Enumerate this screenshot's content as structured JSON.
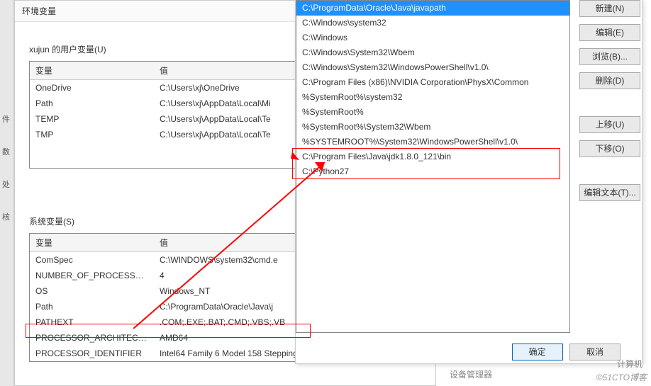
{
  "leftStrip": [
    "件",
    "数",
    "处",
    "核"
  ],
  "bgWindow": {
    "title": "环境变量",
    "userVarsHeader": "xujun 的用户变量(U)",
    "sysVarsHeader": "系统变量(S)",
    "colVar": "变量",
    "colVal": "值",
    "userVars": [
      {
        "name": "OneDrive",
        "value": "C:\\Users\\xj\\OneDrive"
      },
      {
        "name": "Path",
        "value": "C:\\Users\\xj\\AppData\\Local\\Mi"
      },
      {
        "name": "TEMP",
        "value": "C:\\Users\\xj\\AppData\\Local\\Te"
      },
      {
        "name": "TMP",
        "value": "C:\\Users\\xj\\AppData\\Local\\Te"
      }
    ],
    "sysVars": [
      {
        "name": "ComSpec",
        "value": "C:\\WINDOWS\\system32\\cmd.e"
      },
      {
        "name": "NUMBER_OF_PROCESSORS",
        "value": "4"
      },
      {
        "name": "OS",
        "value": "Windows_NT"
      },
      {
        "name": "Path",
        "value": "C:\\ProgramData\\Oracle\\Java\\j"
      },
      {
        "name": "PATHEXT",
        "value": ".COM;.EXE;.BAT;.CMD;.VBS;.VB"
      },
      {
        "name": "PROCESSOR_ARCHITECTU...",
        "value": "AMD64"
      },
      {
        "name": "PROCESSOR_IDENTIFIER",
        "value": "Intel64 Family 6 Model 158 Stepping 9, GenuineIntel"
      }
    ],
    "btnNew": "新建(N)..."
  },
  "popup": {
    "items": [
      {
        "text": "C:\\ProgramData\\Oracle\\Java\\javapath",
        "selected": true
      },
      {
        "text": "C:\\Windows\\system32"
      },
      {
        "text": "C:\\Windows"
      },
      {
        "text": "C:\\Windows\\System32\\Wbem"
      },
      {
        "text": "C:\\Windows\\System32\\WindowsPowerShell\\v1.0\\"
      },
      {
        "text": "C:\\Program Files (x86)\\NVIDIA Corporation\\PhysX\\Common"
      },
      {
        "text": "%SystemRoot%\\system32"
      },
      {
        "text": "%SystemRoot%"
      },
      {
        "text": "%SystemRoot%\\System32\\Wbem"
      },
      {
        "text": "%SYSTEMROOT%\\System32\\WindowsPowerShell\\v1.0\\"
      },
      {
        "text": "C:\\Program Files\\Java\\jdk1.8.0_121\\bin"
      },
      {
        "text": "C:\\Python27"
      }
    ],
    "btns": {
      "new": "新建(N)",
      "edit": "编辑(E)",
      "browse": "浏览(B)...",
      "delete": "删除(D)",
      "up": "上移(U)",
      "down": "下移(O)",
      "editText": "编辑文本(T)..."
    },
    "ok": "确定",
    "cancel": "取消"
  },
  "behind": {
    "devmgr": "设备管理器",
    "calc": "计算机"
  },
  "watermark": "©51CTO博客"
}
